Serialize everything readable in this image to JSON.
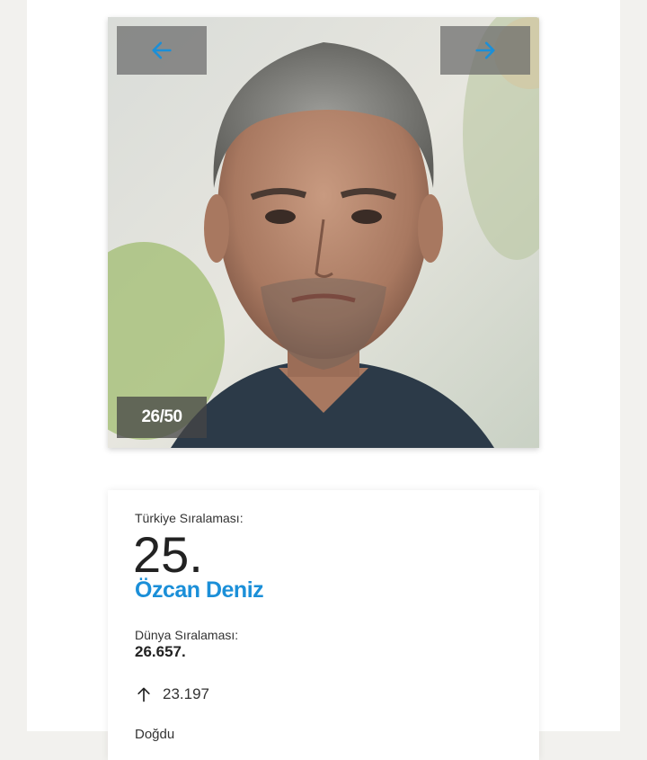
{
  "gallery": {
    "prev_icon": "arrow-left-icon",
    "next_icon": "arrow-right-icon",
    "counter": "26/50",
    "accent_color": "#1b8fd8"
  },
  "profile": {
    "turkey_rank_label": "Türkiye Sıralaması:",
    "turkey_rank": "25.",
    "name": "Özcan Deniz",
    "world_rank_label": "Dünya Sıralaması:",
    "world_rank": "26.657.",
    "trend_icon": "arrow-up-icon",
    "trend_value": "23.197",
    "next_label_partial": "Doğdu"
  }
}
